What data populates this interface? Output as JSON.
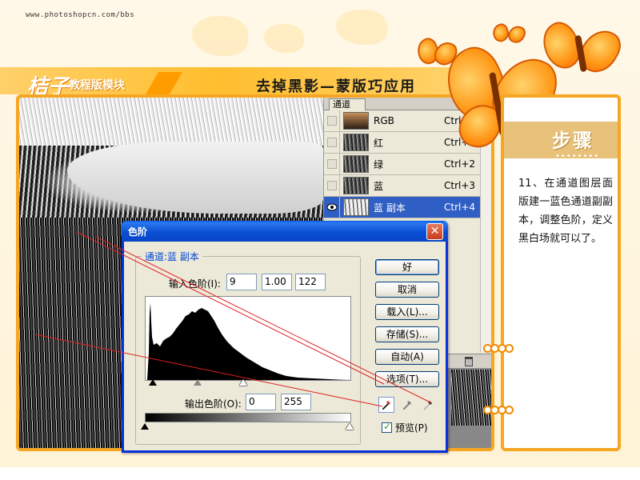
{
  "site": {
    "url": "www.photoshopcn.com/bbs"
  },
  "header": {
    "logo": "桔子",
    "logo_sub": "教程版模块",
    "lesson_title": "去掉黑影—蒙版巧应用"
  },
  "channels_panel": {
    "tab": "通道",
    "rows": [
      {
        "name": "RGB",
        "shortcut": "Ctrl+~",
        "visible": false,
        "selected": false
      },
      {
        "name": "红",
        "shortcut": "Ctrl+1",
        "visible": false,
        "selected": false
      },
      {
        "name": "绿",
        "shortcut": "Ctrl+2",
        "visible": false,
        "selected": false
      },
      {
        "name": "蓝",
        "shortcut": "Ctrl+3",
        "visible": false,
        "selected": false
      },
      {
        "name": "蓝 副本",
        "shortcut": "Ctrl+4",
        "visible": true,
        "selected": true
      }
    ]
  },
  "steps_panel": {
    "title": "步骤",
    "dots": "••••••••",
    "text": "11、在通道图层面版建一蓝色通道副副本，调整色阶，定义黑白场就可以了。"
  },
  "levels_dialog": {
    "title": "色阶",
    "close_label": "✕",
    "channel_label": "通道:蓝 副本",
    "input_label": "输入色阶(I):",
    "input_values": [
      "9",
      "1.00",
      "122"
    ],
    "output_label": "输出色阶(O):",
    "output_values": [
      "0",
      "255"
    ],
    "buttons": {
      "ok": "好",
      "cancel": "取消",
      "load": "载入(L)...",
      "save": "存储(S)...",
      "auto": "自动(A)",
      "options": "选项(T)..."
    },
    "preview_label": "预览(P)",
    "preview_checked": true
  },
  "colors": {
    "accent": "#f5a623",
    "dialog_title": "#0b4fd4",
    "selection": "#2f5ec4",
    "annotation_line": "#e02020"
  }
}
